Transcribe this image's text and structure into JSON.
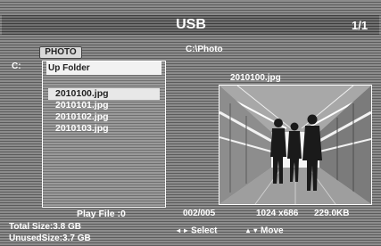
{
  "header": {
    "title": "USB",
    "page_indicator": "1/1"
  },
  "tabs": {
    "active_label": "PHOTO"
  },
  "path": "C:\\Photo",
  "drive_label": "C:",
  "file_browser": {
    "up_folder_label": "Up Folder",
    "items": [
      {
        "name": "2010100.jpg",
        "selected": true
      },
      {
        "name": "2010101.jpg",
        "selected": false
      },
      {
        "name": "2010102.jpg",
        "selected": false
      },
      {
        "name": "2010103.jpg",
        "selected": false
      }
    ]
  },
  "preview": {
    "file_name": "2010100.jpg",
    "image_subject": "people walking in a train station corridor",
    "resolution": "1024 x686",
    "file_size": "229.0KB"
  },
  "status": {
    "play_file": "Play File :0",
    "file_index": "002/005",
    "total_size": "Total Size:3.8  GB",
    "unused_size": "UnusedSize:3.7  GB"
  },
  "hints": {
    "select_label": "Select",
    "move_label": "Move",
    "select_icon": "left-right-arrows-icon",
    "move_icon": "up-down-arrows-icon"
  },
  "colors": {
    "background": "#8c8c8c",
    "title_bar": "#6f6f6f",
    "selection": "#e8e8e8",
    "text": "#ffffff"
  }
}
